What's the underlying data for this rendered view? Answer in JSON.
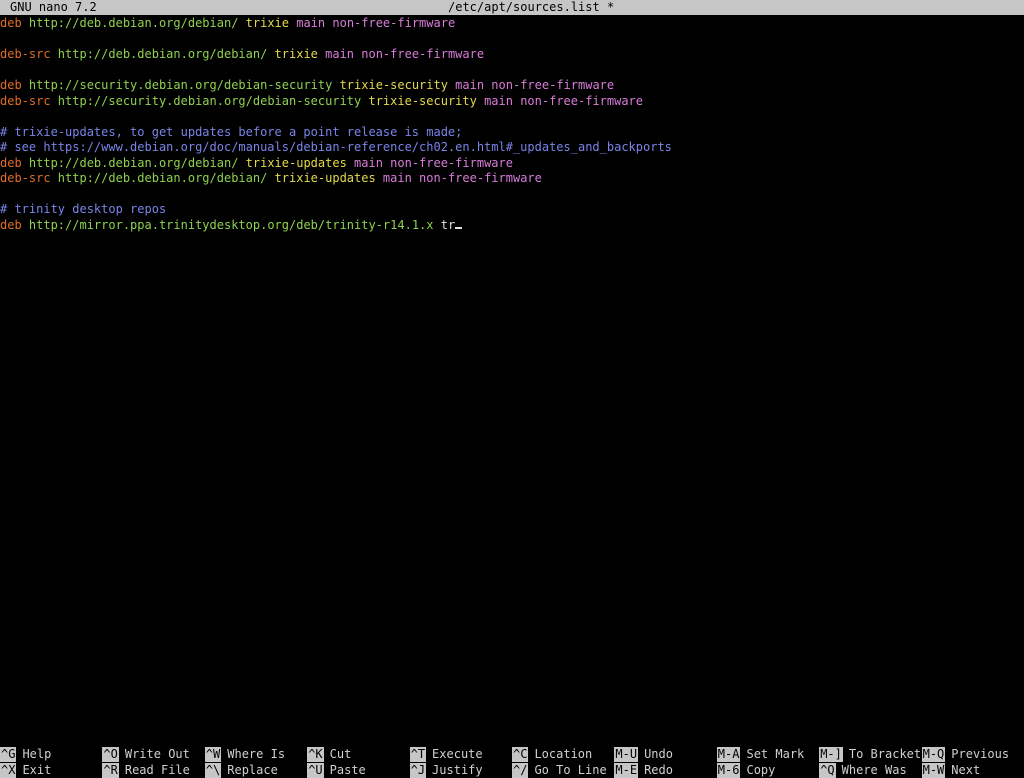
{
  "titlebar": {
    "app": "GNU nano 7.2",
    "file": "/etc/apt/sources.list *"
  },
  "lines": [
    {
      "segments": [
        {
          "t": "deb",
          "c": "kw"
        },
        {
          "t": " http://deb.debian.org/debian/",
          "c": "url"
        },
        {
          "t": " trixie",
          "c": "dist"
        },
        {
          "t": " main non-free-firmware",
          "c": "comp"
        }
      ]
    },
    {
      "segments": []
    },
    {
      "segments": [
        {
          "t": "deb-src",
          "c": "kw"
        },
        {
          "t": " http://deb.debian.org/debian/",
          "c": "url"
        },
        {
          "t": " trixie",
          "c": "dist"
        },
        {
          "t": " main non-free-firmware",
          "c": "comp"
        }
      ]
    },
    {
      "segments": []
    },
    {
      "segments": [
        {
          "t": "deb",
          "c": "kw"
        },
        {
          "t": " http://security.debian.org/debian-security",
          "c": "url"
        },
        {
          "t": " trixie-security",
          "c": "dist"
        },
        {
          "t": " main non-free-firmware",
          "c": "comp"
        }
      ]
    },
    {
      "segments": [
        {
          "t": "deb-src",
          "c": "kw"
        },
        {
          "t": " http://security.debian.org/debian-security",
          "c": "url"
        },
        {
          "t": " trixie-security",
          "c": "dist"
        },
        {
          "t": " main non-free-firmware",
          "c": "comp"
        }
      ]
    },
    {
      "segments": []
    },
    {
      "segments": [
        {
          "t": "# trixie-updates, to get updates before a point release is made;",
          "c": "cmt"
        }
      ]
    },
    {
      "segments": [
        {
          "t": "# see https://www.debian.org/doc/manuals/debian-reference/ch02.en.html#_updates_and_backports",
          "c": "cmt"
        }
      ]
    },
    {
      "segments": [
        {
          "t": "deb",
          "c": "kw"
        },
        {
          "t": " http://deb.debian.org/debian/",
          "c": "url"
        },
        {
          "t": " trixie-updates",
          "c": "dist"
        },
        {
          "t": " main non-free-firmware",
          "c": "comp"
        }
      ]
    },
    {
      "segments": [
        {
          "t": "deb-src",
          "c": "kw"
        },
        {
          "t": " http://deb.debian.org/debian/",
          "c": "url"
        },
        {
          "t": " trixie-updates",
          "c": "dist"
        },
        {
          "t": " main non-free-firmware",
          "c": "comp"
        }
      ]
    },
    {
      "segments": []
    },
    {
      "segments": [
        {
          "t": "# trinity desktop repos",
          "c": "cmt"
        }
      ]
    },
    {
      "segments": [
        {
          "t": "deb",
          "c": "kw"
        },
        {
          "t": " http://mirror.ppa.trinitydesktop.org/deb/trinity-r14.1.x",
          "c": "url"
        },
        {
          "t": " tr",
          "c": "plain"
        }
      ],
      "cursor": true
    }
  ],
  "shortcuts": [
    [
      {
        "key": "^G",
        "label": "Help"
      },
      {
        "key": "^X",
        "label": "Exit"
      }
    ],
    [
      {
        "key": "^O",
        "label": "Write Out"
      },
      {
        "key": "^R",
        "label": "Read File"
      }
    ],
    [
      {
        "key": "^W",
        "label": "Where Is"
      },
      {
        "key": "^\\",
        "label": "Replace"
      }
    ],
    [
      {
        "key": "^K",
        "label": "Cut"
      },
      {
        "key": "^U",
        "label": "Paste"
      }
    ],
    [
      {
        "key": "^T",
        "label": "Execute"
      },
      {
        "key": "^J",
        "label": "Justify"
      }
    ],
    [
      {
        "key": "^C",
        "label": "Location"
      },
      {
        "key": "^/",
        "label": "Go To Line"
      }
    ],
    [
      {
        "key": "M-U",
        "label": "Undo"
      },
      {
        "key": "M-E",
        "label": "Redo"
      }
    ],
    [
      {
        "key": "M-A",
        "label": "Set Mark"
      },
      {
        "key": "M-6",
        "label": "Copy"
      }
    ],
    [
      {
        "key": "M-]",
        "label": "To Bracket"
      },
      {
        "key": "^Q",
        "label": "Where Was"
      }
    ],
    [
      {
        "key": "M-Q",
        "label": "Previous"
      },
      {
        "key": "M-W",
        "label": "Next"
      }
    ]
  ]
}
